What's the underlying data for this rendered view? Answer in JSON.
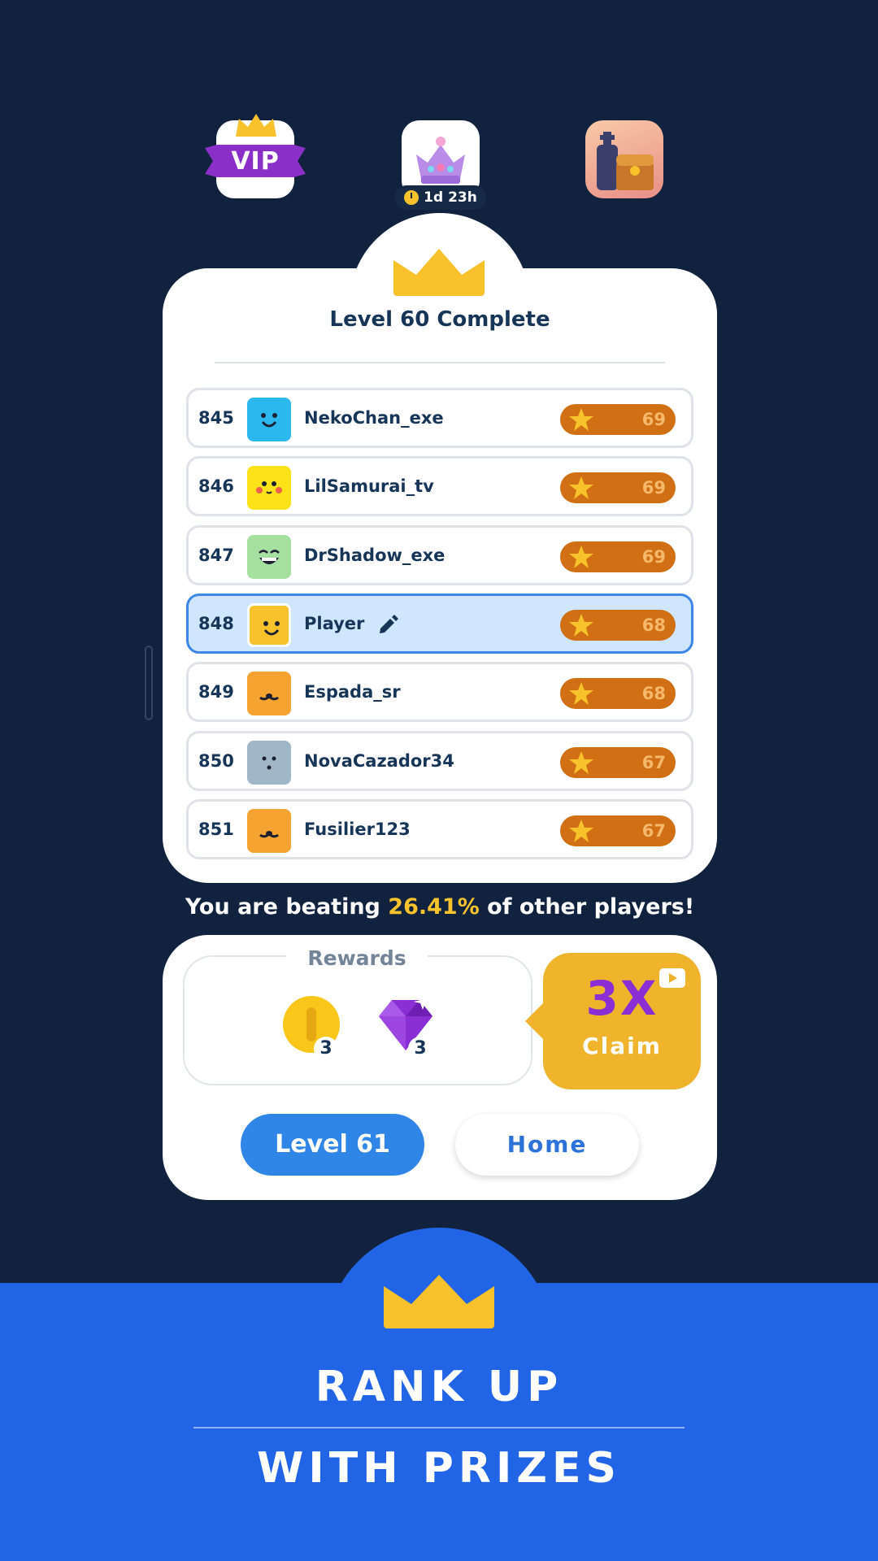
{
  "top_bar": {
    "vip_label": "VIP",
    "event_timer": "1d 23h"
  },
  "card": {
    "title": "Level 60 Complete"
  },
  "leaderboard": [
    {
      "rank": "845",
      "name": "NekoChan_exe",
      "score": "69",
      "avatar_color": "#2bb8ef",
      "face": "smile",
      "is_player": false
    },
    {
      "rank": "846",
      "name": "LilSamurai_tv",
      "score": "69",
      "avatar_color": "#fce219",
      "face": "cheeks",
      "is_player": false
    },
    {
      "rank": "847",
      "name": "DrShadow_exe",
      "score": "69",
      "avatar_color": "#a5e0a0",
      "face": "grin",
      "is_player": false
    },
    {
      "rank": "848",
      "name": "Player",
      "score": "68",
      "avatar_color": "#f7c22c",
      "face": "smile",
      "is_player": true
    },
    {
      "rank": "849",
      "name": "Espada_sr",
      "score": "68",
      "avatar_color": "#f5a331",
      "face": "cat",
      "is_player": false
    },
    {
      "rank": "850",
      "name": "NovaCazador34",
      "score": "67",
      "avatar_color": "#9fb7c7",
      "face": "dots",
      "is_player": false
    },
    {
      "rank": "851",
      "name": "Fusilier123",
      "score": "67",
      "avatar_color": "#f5a331",
      "face": "cat",
      "is_player": false
    }
  ],
  "beating": {
    "prefix": "You are beating ",
    "percent": "26.41%",
    "suffix": " of other players!"
  },
  "rewards": {
    "label": "Rewards",
    "coin_qty": "3",
    "gem_qty": "3",
    "multiplier": "3X",
    "claim_label": "Claim"
  },
  "buttons": {
    "next_level_label": "Level 61",
    "home_label": "Home"
  },
  "banner": {
    "line1": "RANK UP",
    "line2": "WITH PRIZES"
  },
  "colors": {
    "background": "#11223e",
    "accent_blue": "#2264e6",
    "gold": "#f7c22c",
    "score_pill": "#d06f13",
    "player_highlight": "#cfe6fc"
  },
  "icons": [
    "vip-icon",
    "crown-event-icon",
    "clock-icon",
    "treasure-chest-icon",
    "crown-icon",
    "star-icon",
    "edit-pencil-icon",
    "coin-icon",
    "gem-icon",
    "video-icon"
  ]
}
